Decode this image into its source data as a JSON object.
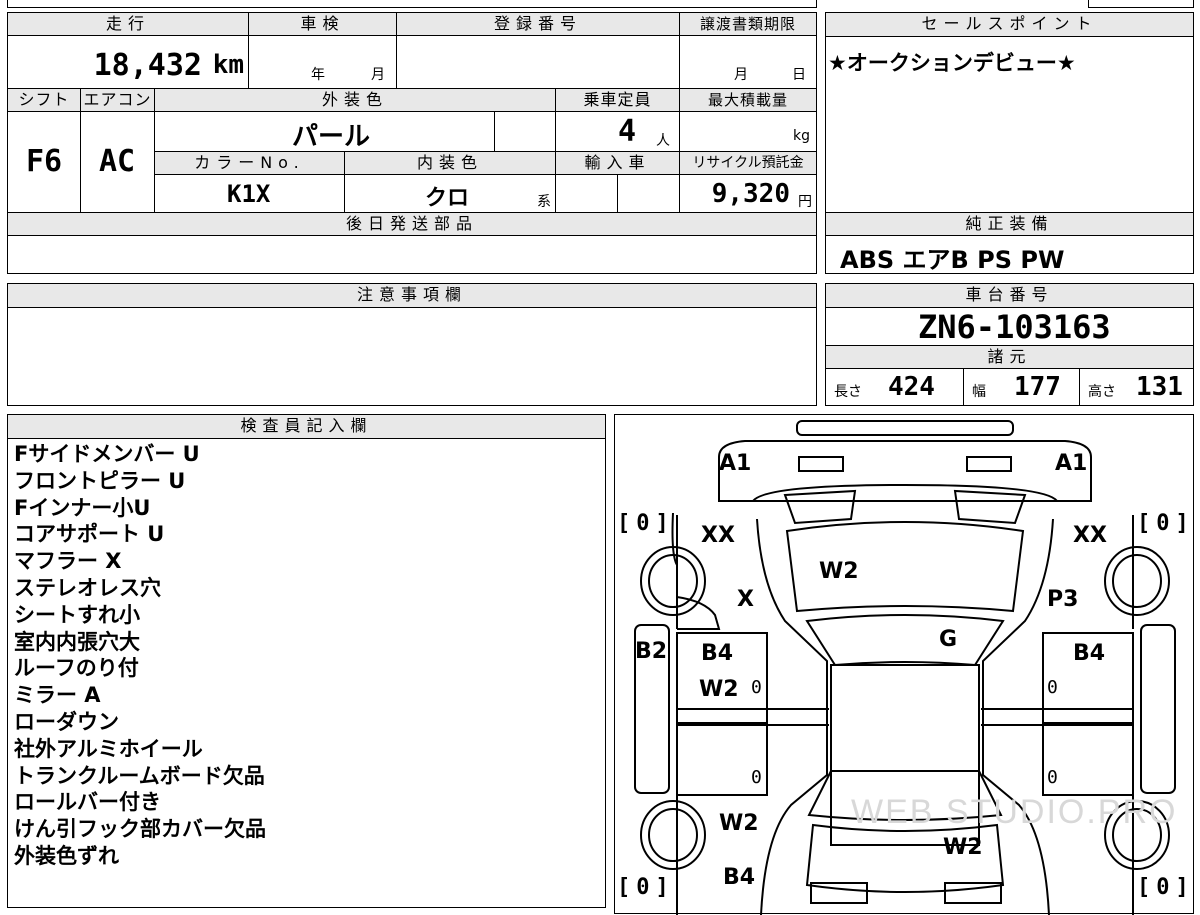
{
  "top_row": {
    "mileage_header": "走行",
    "mileage_value": "18,432",
    "mileage_unit": "km",
    "inspection_header": "車検",
    "inspection_year_unit": "年",
    "inspection_month_unit": "月",
    "registration_header": "登録番号",
    "transfer_header": "譲渡書類期限",
    "transfer_month_unit": "月",
    "transfer_day_unit": "日"
  },
  "sales_point": {
    "header": "セールスポイント",
    "text": "★オークションデビュー★"
  },
  "second_row": {
    "shift_header": "シフト",
    "shift_value": "F6",
    "ac_header": "エアコン",
    "ac_value": "AC",
    "exterior_color_header": "外装色",
    "exterior_color_value": "パール",
    "capacity_header": "乗車定員",
    "capacity_value": "4",
    "capacity_unit": "人",
    "max_load_header": "最大積載量",
    "max_load_unit": "kg",
    "color_no_header": "カラーNo.",
    "color_no_value": "K1X",
    "interior_color_header": "内装色",
    "interior_color_value": "クロ",
    "interior_color_suffix": "系",
    "import_header": "輸入車",
    "recycle_header": "リサイクル預託金",
    "recycle_value": "9,320",
    "recycle_unit": "円"
  },
  "later_parts": {
    "header": "後日発送部品",
    "value": ""
  },
  "genuine_equipment": {
    "header": "純正装備",
    "value": "ABS エアB PS PW"
  },
  "caution": {
    "header": "注意事項欄",
    "value": ""
  },
  "chassis": {
    "header": "車台番号",
    "value": "ZN6-103163"
  },
  "specs": {
    "header": "諸元",
    "length_label": "長さ",
    "length_value": "424",
    "width_label": "幅",
    "width_value": "177",
    "height_label": "高さ",
    "height_value": "131"
  },
  "inspector": {
    "header": "検査員記入欄",
    "notes": [
      "Fサイドメンバー U",
      "フロントピラー U",
      "Fインナー小U",
      "コアサポート U",
      "マフラー X",
      "ステレオレス穴",
      "シートすれ小",
      "室内内張穴大",
      "ルーフのり付",
      "ミラー A",
      "ローダウン",
      "社外アルミホイール",
      "トランクルームボード欠品",
      "ロールバー付き",
      "けん引フック部カバー欠品",
      "外装色ずれ"
    ]
  },
  "diagram": {
    "watermark": "WEB STUDIO.PRO",
    "labels": {
      "a1_left": "A1",
      "a1_right": "A1",
      "xx_left": "XX",
      "xx_right": "XX",
      "w2_hood": "W2",
      "x_left_fender": "X",
      "p3_right_fender": "P3",
      "g_windshield": "G",
      "b2_left_pillar": "B2",
      "b4_left_front_door": "B4",
      "w2_left_front_door": "W2",
      "b4_right_front_door": "B4",
      "w2_left_quarter": "W2",
      "w2_trunk": "W2",
      "b4_left_rear": "B4"
    },
    "tires": {
      "front_left": "0",
      "front_right": "0",
      "rear_left": "0",
      "rear_right": "0"
    },
    "door_zeros": {
      "front_left": "0",
      "front_right": "0",
      "rear_left": "0",
      "rear_right": "0"
    }
  }
}
